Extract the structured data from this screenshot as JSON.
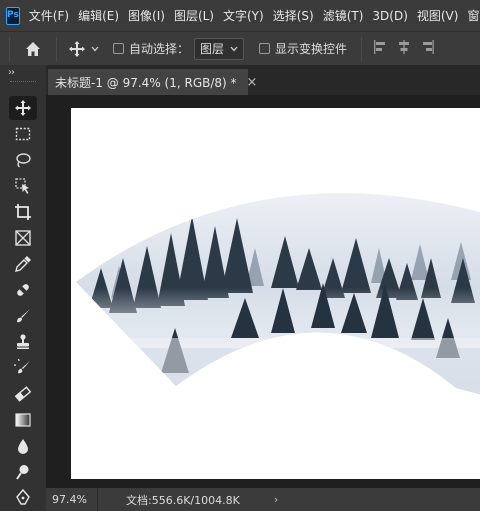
{
  "menubar": {
    "app_icon": "Ps",
    "items": [
      "文件(F)",
      "编辑(E)",
      "图像(I)",
      "图层(L)",
      "文字(Y)",
      "选择(S)",
      "滤镜(T)",
      "3D(D)",
      "视图(V)",
      "窗"
    ]
  },
  "options": {
    "auto_select_label": "自动选择：",
    "layer_dropdown": "图层",
    "transform_label": "显示变换控件"
  },
  "document_tab": {
    "title": "未标题-1 @ 97.4% (1, RGB/8) *",
    "close": "×"
  },
  "status": {
    "zoom": "97.4%",
    "doc_info": "文档:556.6K/1004.8K",
    "arrow": "›"
  },
  "icons": [
    "home-icon",
    "move-icon",
    "marquee-icon",
    "lasso-icon",
    "object-select-icon",
    "crop-icon",
    "frame-icon",
    "eyedropper-icon",
    "healing-icon",
    "brush-icon",
    "stamp-icon",
    "history-brush-icon",
    "eraser-icon",
    "gradient-icon",
    "blur-icon",
    "dodge-icon",
    "pen-icon"
  ],
  "colors": {
    "accent": "#31a8ff",
    "panel": "#3b3b3b",
    "canvas": "#ffffff"
  }
}
